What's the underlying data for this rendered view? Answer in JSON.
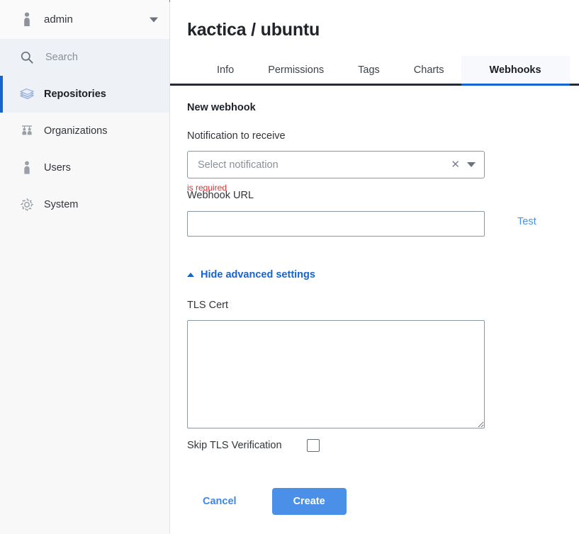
{
  "sidebar": {
    "account": {
      "name": "admin",
      "icon": "person-icon",
      "caret": "chevron-down-icon"
    },
    "search": {
      "placeholder": "Search",
      "value": "",
      "icon": "search-icon"
    },
    "items": [
      {
        "label": "Repositories",
        "icon": "repositories-icon",
        "active": true
      },
      {
        "label": "Organizations",
        "icon": "organizations-icon",
        "active": false
      },
      {
        "label": "Users",
        "icon": "users-icon",
        "active": false
      },
      {
        "label": "System",
        "icon": "gear-icon",
        "active": false
      }
    ]
  },
  "header": {
    "title": "kactica / ubuntu",
    "tabs": [
      {
        "label": "Info",
        "active": false
      },
      {
        "label": "Permissions",
        "active": false
      },
      {
        "label": "Tags",
        "active": false
      },
      {
        "label": "Charts",
        "active": false
      },
      {
        "label": "Webhooks",
        "active": true
      }
    ]
  },
  "form": {
    "section_title": "New webhook",
    "notification": {
      "label": "Notification to receive",
      "placeholder": "Select notification",
      "value": "",
      "error": "is required",
      "clear_icon": "close-icon",
      "caret_icon": "chevron-down-icon"
    },
    "webhook_url": {
      "label": "Webhook URL",
      "value": "",
      "placeholder": "",
      "test_label": "Test"
    },
    "advanced": {
      "toggle_label": "Hide advanced settings",
      "caret_icon": "chevron-up-icon",
      "tls_cert": {
        "label": "TLS Cert",
        "value": "",
        "placeholder": ""
      },
      "skip_tls": {
        "label": "Skip TLS Verification",
        "checked": false
      }
    },
    "actions": {
      "cancel_label": "Cancel",
      "create_label": "Create"
    }
  },
  "colors": {
    "accent_blue": "#1564d4",
    "button_blue": "#4a90e8",
    "link_blue": "#3d87e8",
    "error_red": "#e03030",
    "tab_border": "#232b38",
    "sidebar_active_bg": "#eef1f6"
  }
}
